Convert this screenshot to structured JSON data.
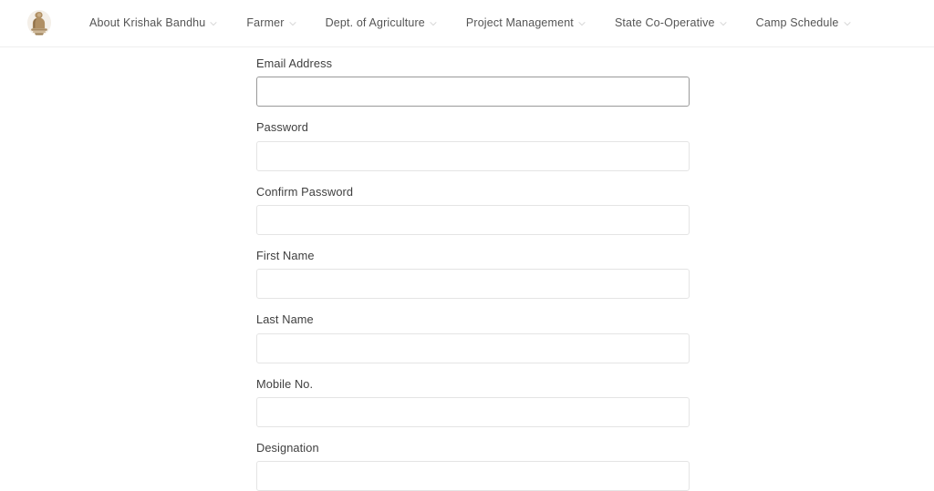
{
  "header": {
    "logo": {
      "name": "state-emblem-logo",
      "alt": "Government emblem"
    },
    "nav_items": [
      {
        "label": "About Krishak Bandhu",
        "has_dropdown": true
      },
      {
        "label": "Farmer",
        "has_dropdown": true
      },
      {
        "label": "Dept. of Agriculture",
        "has_dropdown": true
      },
      {
        "label": "Project Management",
        "has_dropdown": true
      },
      {
        "label": "State Co-Operative",
        "has_dropdown": true
      },
      {
        "label": "Camp Schedule",
        "has_dropdown": true
      }
    ]
  },
  "form": {
    "fields": [
      {
        "label": "Email Address",
        "value": "",
        "placeholder": "",
        "type": "email",
        "focused": true
      },
      {
        "label": "Password",
        "value": "",
        "placeholder": "",
        "type": "password",
        "focused": false
      },
      {
        "label": "Confirm Password",
        "value": "",
        "placeholder": "",
        "type": "password",
        "focused": false
      },
      {
        "label": "First Name",
        "value": "",
        "placeholder": "",
        "type": "text",
        "focused": false
      },
      {
        "label": "Last Name",
        "value": "",
        "placeholder": "",
        "type": "text",
        "focused": false
      },
      {
        "label": "Mobile No.",
        "value": "",
        "placeholder": "",
        "type": "text",
        "focused": false
      },
      {
        "label": "Designation",
        "value": "",
        "placeholder": "",
        "type": "text",
        "focused": false
      }
    ]
  },
  "colors": {
    "page_background": "#ffffff",
    "header_background": "#ffffff",
    "header_border": "#eeeeee",
    "nav_text": "#555555",
    "label_text": "#3f3f3f",
    "input_border": "#e4e4e4",
    "input_border_focused": "#9a9a9a",
    "logo_accent": "#a98b62"
  }
}
